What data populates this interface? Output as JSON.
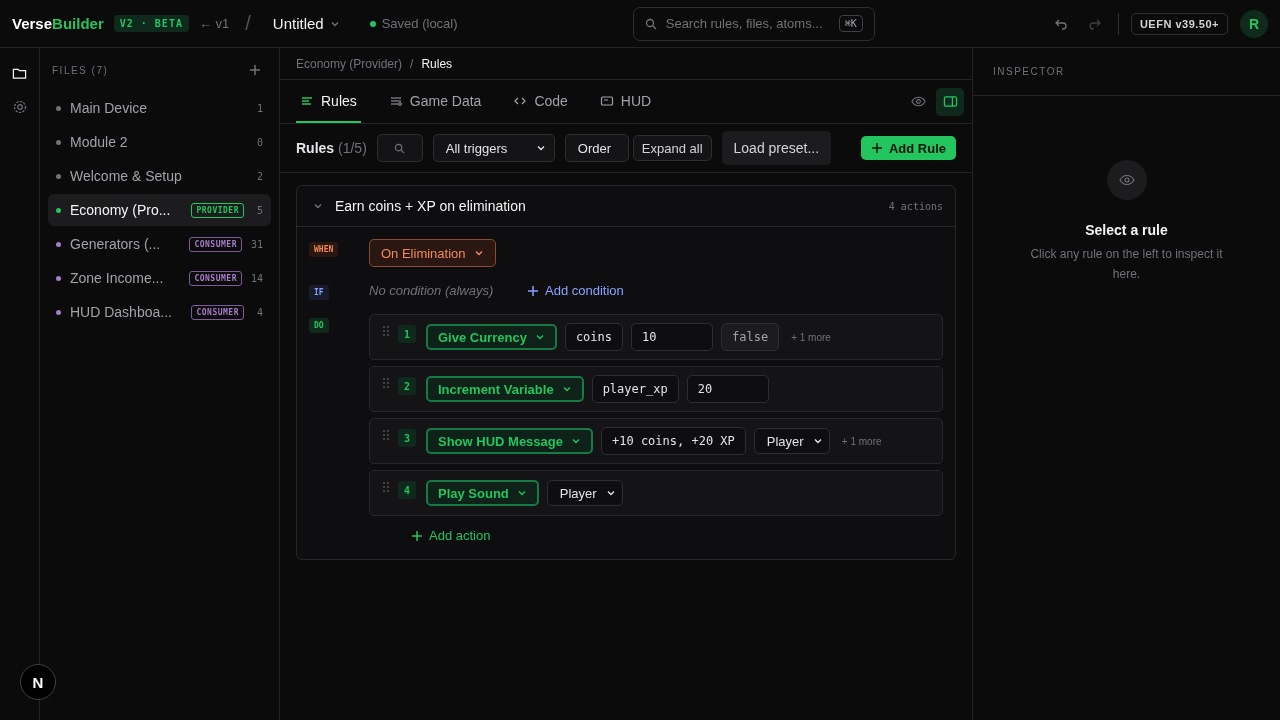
{
  "topbar": {
    "brand_first": "Verse",
    "brand_second": "Builder",
    "version_badge": "V2 · BETA",
    "back_link": "← v1",
    "separator": "/",
    "document_title": "Untitled",
    "save_status": "Saved (local)",
    "search": {
      "placeholder": "Search rules, files, atoms...",
      "shortcut": "⌘K"
    },
    "undo_disabled": false,
    "redo_disabled": true,
    "platform_badge": "UEFN v39.50+",
    "avatar": "R"
  },
  "rail": [
    {
      "kind": "folder",
      "selected": true
    },
    {
      "kind": "settings",
      "selected": false
    }
  ],
  "files": {
    "title": "FILES (7)",
    "items": [
      {
        "name": "Main Device",
        "count": "1",
        "color": "#71717a",
        "selected": false
      },
      {
        "name": "Module 2",
        "count": "0",
        "color": "#71717a",
        "selected": false
      },
      {
        "name": "Welcome & Setup",
        "count": "2",
        "color": "#71717a",
        "selected": false
      },
      {
        "name": "Economy (Pro...",
        "count": "5",
        "color": "#22c55e",
        "selected": true,
        "badge": {
          "label": "PROVIDER",
          "kind": "provider"
        }
      },
      {
        "name": "Generators (...",
        "count": "31",
        "color": "#a77bc8",
        "selected": false,
        "badge": {
          "label": "CONSUMER",
          "kind": "consumer"
        }
      },
      {
        "name": "Zone Income...",
        "count": "14",
        "color": "#a77bc8",
        "selected": false,
        "badge": {
          "label": "CONSUMER",
          "kind": "consumer"
        }
      },
      {
        "name": "HUD Dashboa...",
        "count": "4",
        "color": "#a77bc8",
        "selected": false,
        "badge": {
          "label": "CONSUMER",
          "kind": "consumer"
        }
      }
    ]
  },
  "breadcrumb": {
    "separator": "/",
    "items": [
      "Economy (Provider)",
      "Rules"
    ]
  },
  "tabs": [
    {
      "label": "Rules",
      "kind": "rules",
      "selected": true
    },
    {
      "label": "Game Data",
      "kind": "data",
      "selected": false
    },
    {
      "label": "Code",
      "kind": "code",
      "selected": false
    },
    {
      "label": "HUD",
      "kind": "hud",
      "selected": false
    }
  ],
  "view_toggles": [
    {
      "kind": "eye",
      "selected": false
    },
    {
      "kind": "panel",
      "selected": true
    }
  ],
  "toolbar": {
    "title": "Rules",
    "count": "(1/5)",
    "trigger_filter": "All triggers",
    "order_select": "Order",
    "expand_button": "Expand all",
    "preset_button": "Load preset...",
    "add_button": "Add Rule"
  },
  "rule": {
    "expanded": true,
    "title": "Earn coins + XP on elimination",
    "summary": "4 actions",
    "when_label": "WHEN",
    "trigger": "On Elimination",
    "if_label": "IF",
    "condition_placeholder": "No condition (always)",
    "add_condition": "Add condition",
    "do_label": "DO",
    "actions": [
      {
        "number": "1",
        "name": "Give Currency",
        "params": [
          {
            "kind": "field",
            "value": "coins"
          },
          {
            "kind": "field",
            "value": "10"
          },
          {
            "kind": "bool",
            "value": "false"
          }
        ],
        "more": "+ 1 more"
      },
      {
        "number": "2",
        "name": "Increment Variable",
        "params": [
          {
            "kind": "field",
            "value": "player_xp"
          },
          {
            "kind": "field",
            "value": "20"
          }
        ]
      },
      {
        "number": "3",
        "name": "Show HUD Message",
        "params": [
          {
            "kind": "field",
            "value": "+10 coins, +20 XP"
          },
          {
            "kind": "select",
            "value": "Player"
          }
        ],
        "more": "+ 1 more"
      },
      {
        "number": "4",
        "name": "Play Sound",
        "params": [
          {
            "kind": "select",
            "value": "Player"
          }
        ]
      }
    ],
    "add_action": "Add action"
  },
  "inspector": {
    "title": "INSPECTOR",
    "empty_title": "Select a rule",
    "empty_text": "Click any rule on the left to inspect it here."
  },
  "dev_badge": "N"
}
